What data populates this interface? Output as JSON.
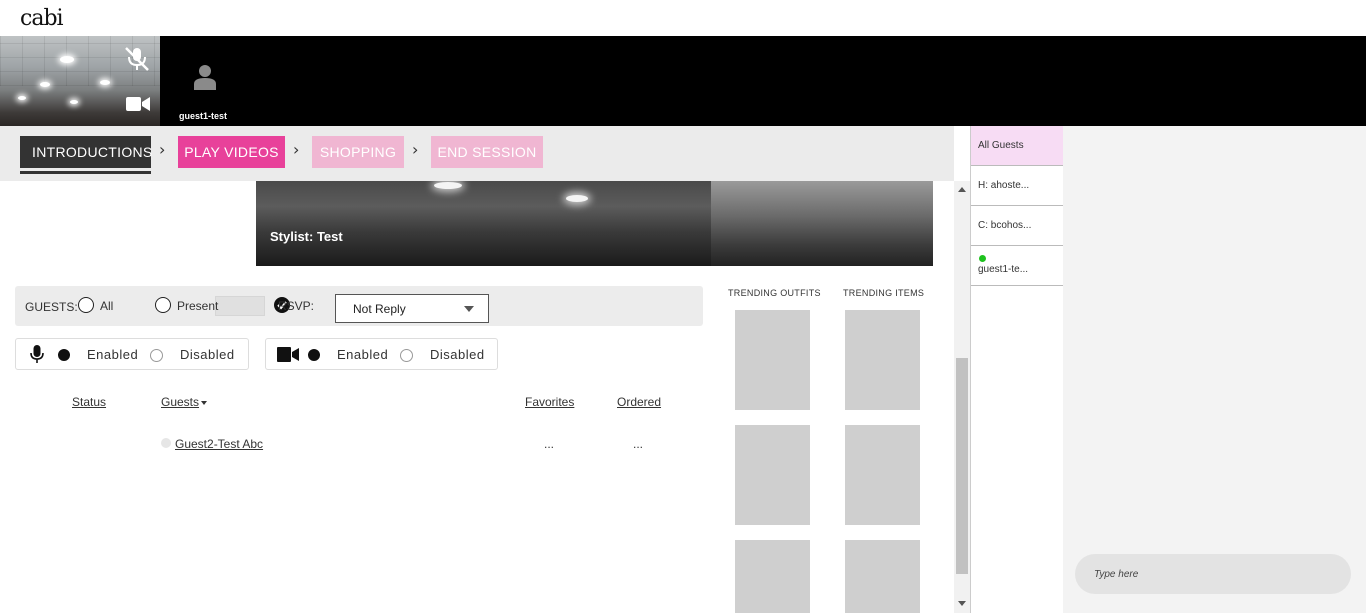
{
  "header": {
    "logo": "cabi"
  },
  "videos": {
    "guest_tile_name": "guest1-test",
    "stylist_label": "Stylist: Test"
  },
  "steps": [
    {
      "label": "INTRODUCTIONS",
      "state": "active"
    },
    {
      "label": "PLAY VIDEOS",
      "state": "current"
    },
    {
      "label": "SHOPPING",
      "state": "disabled"
    },
    {
      "label": "END SESSION",
      "state": "disabled"
    }
  ],
  "filters": {
    "guests_label": "GUESTS:",
    "all_label": "All",
    "present_label": "Present",
    "rsvp_label": "RSVP:",
    "rsvp_selected": "Not Reply"
  },
  "mic_toggle": {
    "enabled_label": "Enabled",
    "disabled_label": "Disabled",
    "selected": "Enabled"
  },
  "cam_toggle": {
    "enabled_label": "Enabled",
    "disabled_label": "Disabled",
    "selected": "Enabled"
  },
  "table": {
    "headers": {
      "status": "Status",
      "guests": "Guests",
      "favorites": "Favorites",
      "ordered": "Ordered"
    },
    "rows": [
      {
        "status": "",
        "guest": "Guest2-Test Abc",
        "favorites": "...",
        "ordered": "..."
      }
    ]
  },
  "trending": {
    "outfits_title": "TRENDING OUTFITS",
    "items_title": "TRENDING ITEMS"
  },
  "guest_list": [
    {
      "label": "All Guests",
      "active": true,
      "online": false
    },
    {
      "label": "H: ahoste...",
      "active": false,
      "online": false
    },
    {
      "label": "C: bcohos...",
      "active": false,
      "online": false
    },
    {
      "label": "guest1-te...",
      "active": false,
      "online": true
    }
  ],
  "chat": {
    "placeholder": "Type here"
  },
  "colors": {
    "accent_pink": "#e8419a",
    "disabled_pink": "#f0b6d2",
    "active_step": "#333333",
    "online_green": "#1ec21e",
    "selected_guest_bg": "#f7dcf4"
  },
  "icons": {
    "mic_muted": "mic-off-icon",
    "camera": "video-camera-icon",
    "avatar": "user-icon",
    "mic": "microphone-icon",
    "cam": "video-camera-icon",
    "check": "checkmark-icon",
    "dropdown": "caret-down-icon"
  }
}
